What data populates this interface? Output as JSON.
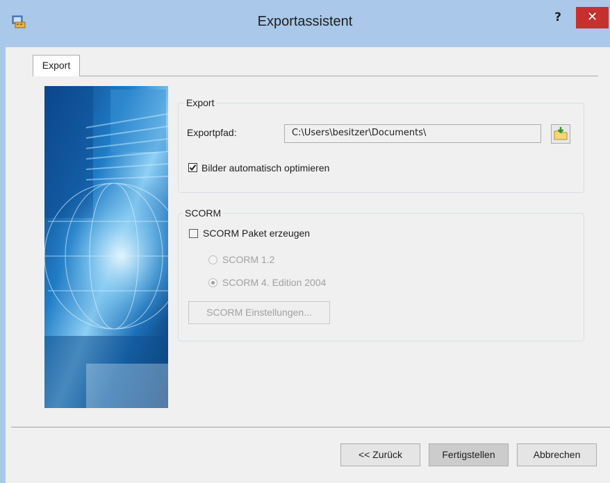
{
  "window": {
    "title": "Exportassistent",
    "help_label": "?",
    "close_label": "✕"
  },
  "tabs": [
    {
      "label": "Export"
    }
  ],
  "export_group": {
    "legend": "Export",
    "path_label": "Exportpfad:",
    "path_value": "C:\\Users\\besitzer\\Documents\\",
    "optimize_label": "Bilder automatisch optimieren",
    "optimize_checked": true
  },
  "scorm_group": {
    "legend": "SCORM",
    "create_label": "SCORM Paket erzeugen",
    "create_checked": false,
    "option_12": "SCORM 1.2",
    "option_2004": "SCORM 4. Edition 2004",
    "selected_option": "SCORM 4. Edition 2004",
    "settings_button": "SCORM Einstellungen..."
  },
  "footer": {
    "back": "<< Zurück",
    "finish": "Fertigstellen",
    "cancel": "Abbrechen"
  },
  "colors": {
    "titlebar": "#aac8ea",
    "close": "#c7312d",
    "disabled": "#a0a0a0"
  }
}
